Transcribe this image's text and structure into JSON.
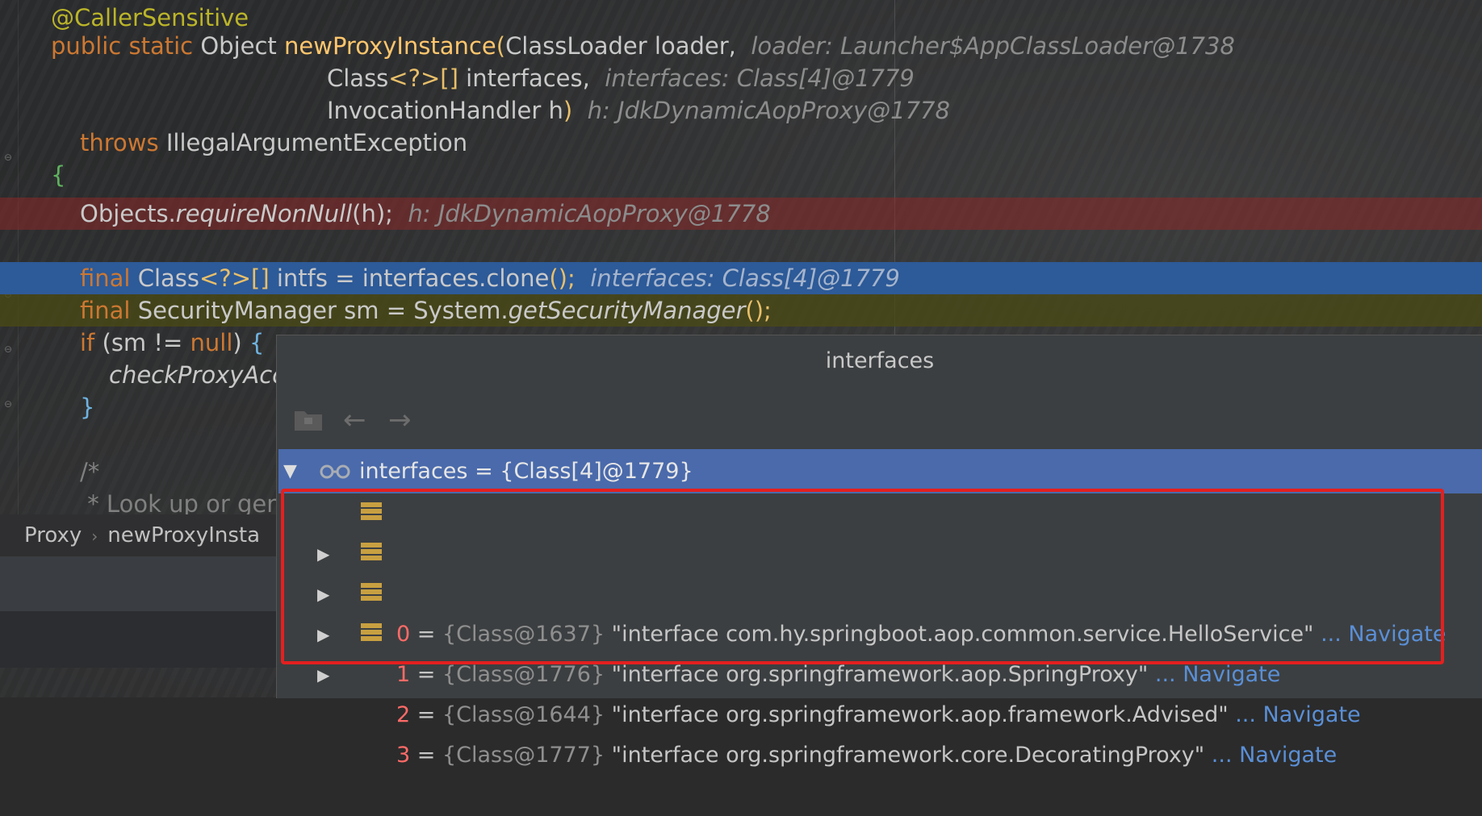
{
  "editor": {
    "lines": {
      "annotation": "@CallerSensitive",
      "sig_public": "public static",
      "sig_type": "Object",
      "sig_method": "newProxyInstance",
      "sig_open": "(",
      "sig_param1": "ClassLoader loader,",
      "sig_hint1": "loader: Launcher$AppClassLoader@1738",
      "sig_param2_type": "Class",
      "sig_param2_gen": "<?>",
      "sig_param2_arr": "[]",
      "sig_param2_name": " interfaces,",
      "sig_hint2": "interfaces: Class[4]@1779",
      "sig_param3": "InvocationHandler h",
      "sig_close": ")",
      "sig_hint3": "h: JdkDynamicAopProxy@1778",
      "throws_kw": "throws",
      "throws_type": "IllegalArgumentException",
      "open_brace": "{",
      "req_obj": "Objects.",
      "req_fn": "requireNonNull",
      "req_args": "(h);",
      "req_hint": "h: JdkDynamicAopProxy@1778",
      "cur_final": "final",
      "cur_type": "Class",
      "cur_gen": "<?>",
      "cur_arr": "[]",
      "cur_rest": " intfs = interfaces.clone",
      "cur_paren": "();",
      "cur_hint": "interfaces: Class[4]@1779",
      "sm_final": "final",
      "sm_rest": "SecurityManager sm = System.",
      "sm_fn": "getSecurityManager",
      "sm_paren": "();",
      "if_kw": "if",
      "if_rest": "(sm != ",
      "if_null": "null",
      "if_end": ") ",
      "if_brace": "{",
      "check_fn": "checkProxyAcc",
      "close_brace": "}",
      "comment_open": "/*",
      "comment_line": " * Look up or gen"
    }
  },
  "breadcrumb": {
    "items": [
      "Proxy",
      "newProxyInsta"
    ],
    "separator": "›"
  },
  "popup": {
    "title": "interfaces",
    "toolbar": {
      "folder_icon": "folder-icon",
      "back_icon": "←",
      "forward_icon": "→"
    },
    "root": {
      "expander": "▼",
      "icon": "watch-glasses-icon",
      "label": "interfaces = {Class[4]@1779}"
    },
    "children": [
      {
        "index": "0",
        "eq": " = ",
        "ref": "{Class@1637}",
        "value": " \"interface com.hy.springboot.aop.common.service.HelloService\"",
        "nav": " ... Navigate"
      },
      {
        "index": "1",
        "eq": " = ",
        "ref": "{Class@1776}",
        "value": " \"interface org.springframework.aop.SpringProxy\"",
        "nav": " ... Navigate"
      },
      {
        "index": "2",
        "eq": " = ",
        "ref": "{Class@1644}",
        "value": " \"interface org.springframework.aop.framework.Advised\"",
        "nav": " ... Navigate"
      },
      {
        "index": "3",
        "eq": " = ",
        "ref": "{Class@1777}",
        "value": " \"interface org.springframework.core.DecoratingProxy\"",
        "nav": " ... Navigate"
      }
    ],
    "child_expander": "▶"
  },
  "colors": {
    "highlight_box": "#e3201f",
    "root_selection": "#4a6aab",
    "current_line": "#2d5a98"
  }
}
